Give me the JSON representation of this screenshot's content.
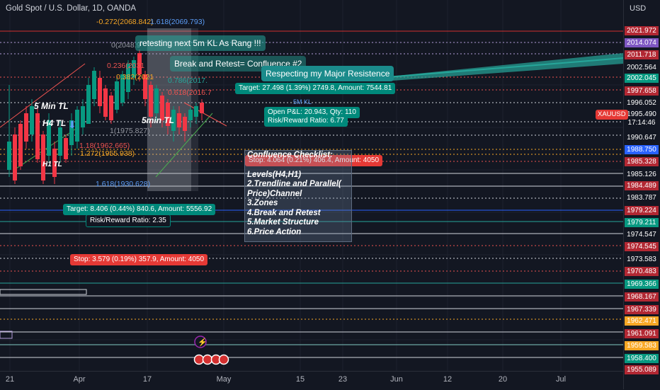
{
  "header": {
    "title": "Gold Spot / U.S. Dollar, 1D, OANDA",
    "currency": "USD"
  },
  "price_axis": [
    {
      "text": "2021.972",
      "bg": "#b22833"
    },
    {
      "text": "2014.074",
      "bg": "#7e57c2"
    },
    {
      "text": "2011.718",
      "bg": "#b22833"
    },
    {
      "text": "2002.564",
      "bg": "#131722"
    },
    {
      "text": "2002.045",
      "bg": "#089981"
    },
    {
      "text": "1997.658",
      "bg": "#b22833"
    },
    {
      "text": "1996.052",
      "bg": "#131722"
    },
    {
      "text": "1995.490",
      "bg": "#131722"
    },
    {
      "text": "17:14:46",
      "bg": "#131722"
    },
    {
      "text": "1990.647",
      "bg": "#131722"
    },
    {
      "text": "1988.750",
      "bg": "#2962ff"
    },
    {
      "text": "1985.328",
      "bg": "#b22833"
    },
    {
      "text": "1985.126",
      "bg": "#131722"
    },
    {
      "text": "1984.489",
      "bg": "#b22833"
    },
    {
      "text": "1983.787",
      "bg": "#131722"
    },
    {
      "text": "1979.224",
      "bg": "#b22833"
    },
    {
      "text": "1979.211",
      "bg": "#089981"
    },
    {
      "text": "1974.547",
      "bg": "#131722"
    },
    {
      "text": "1974.545",
      "bg": "#b22833"
    },
    {
      "text": "1973.583",
      "bg": "#131722"
    },
    {
      "text": "1970.483",
      "bg": "#b22833"
    },
    {
      "text": "1969.366",
      "bg": "#089981"
    },
    {
      "text": "1968.167",
      "bg": "#b22833"
    },
    {
      "text": "1967.339",
      "bg": "#b22833"
    },
    {
      "text": "1962.471",
      "bg": "#f9a825"
    },
    {
      "text": "1961.091",
      "bg": "#b22833"
    },
    {
      "text": "1959.583",
      "bg": "#f9a825"
    },
    {
      "text": "1958.400",
      "bg": "#089981"
    },
    {
      "text": "1955.089",
      "bg": "#b22833"
    }
  ],
  "symbol_tag": "XAUUSD",
  "time_axis": [
    "21",
    "Apr",
    "17",
    "May",
    "15",
    "23",
    "Jun",
    "12",
    "20",
    "Jul"
  ],
  "fib_labels": {
    "f_neg272": "-0.272(2068.842)",
    "f_1618": "1.618(2069.793)",
    "f_0": "0(2048.9",
    "f_0236": "0.236(2031",
    "f_0382": "0.382(2021",
    "f_0786": "0.786(2017.",
    "f_0618": "0.618(2016.7",
    "f_1": "1(1975.827)",
    "f_118": "1.18(1962.665)",
    "f_1272": "1.272(1955.938)",
    "f_1618b": "1.618(1930.628)",
    "f_1b": "1(",
    "f_1618c": "1.618",
    "f_1618d": "1.618"
  },
  "annotations": {
    "retest": "retesting next 5m KL As Rang !!!",
    "confluence": "Break and Retest= Confluence #2",
    "respecting": "Respecting my Major Resistence",
    "target_top": "Target: 27.498 (1.39%) 2749.8, Amount: 7544.81",
    "open_pl": "Open P&L: 20.943, Qty: 110",
    "rr_top": "Risk/Reward Ratio: 6.77",
    "stop_mid": "Stop: 4.064 (0.21%) 406.4, Amount: 4050",
    "target_bottom": "Target: 8.406 (0.44%) 840.6, Amount: 5556.92",
    "rr_bottom": "Risk/Reward Ratio: 2.35",
    "stop_bottom": "Stop: 3.579 (0.19%) 357.9, Amount: 4050",
    "tl_5min": "5 Min TL",
    "tl_h4": "H4 TL",
    "tl_h1": "H1 TL",
    "tl_5min_right": "5min TL",
    "five_m_kl": "5M KL"
  },
  "checklist": [
    "Confluence Checklist:",
    "Levels(H4,H1)",
    "2.Trendline and Parallel(",
    "Price)Channel",
    "3.Zones",
    "4.Break and Retest",
    "5.Market Structure",
    "6.Price Action"
  ],
  "colors": {
    "bull": "#089981",
    "bear": "#f23645",
    "accent": "#2962ff",
    "background": "#131722"
  }
}
